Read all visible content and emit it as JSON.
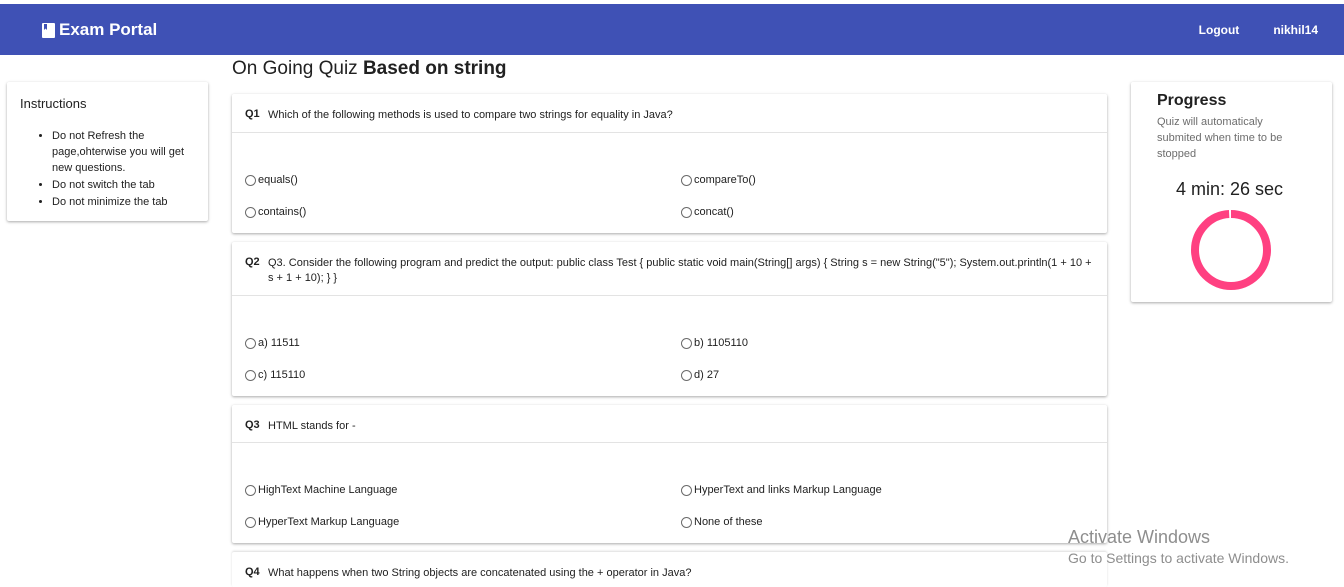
{
  "navbar": {
    "brand": "Exam Portal",
    "brand_icon": "book-icon",
    "logout": "Logout",
    "username": "nikhil14",
    "color": "#3f51b5"
  },
  "instructions": {
    "title": "Instructions",
    "items": [
      "Do not Refresh the page,ohterwise you will get new questions.",
      "Do not switch the tab",
      "Do not minimize the tab"
    ]
  },
  "page": {
    "title_prefix": "On Going Quiz",
    "title_bold": "Based on string"
  },
  "questions": [
    {
      "num": "Q1",
      "text": "Which of the following methods is used to compare two strings for equality in Java?",
      "options": [
        "equals()",
        "compareTo()",
        "contains()",
        "concat()"
      ]
    },
    {
      "num": "Q2",
      "text": "Q3. Consider the following program and predict the output: public class Test { public static void main(String[] args) { String s = new String(\"5\"); System.out.println(1 + 10 + s + 1 + 10); } }",
      "options": [
        "a) 11511",
        "b) 1105110",
        "c) 115110",
        "d) 27"
      ]
    },
    {
      "num": "Q3",
      "text": "HTML stands for -",
      "options": [
        "HighText Machine Language",
        "HyperText and links Markup Language",
        "HyperText Markup Language",
        "None of these"
      ]
    },
    {
      "num": "Q4",
      "text": "What happens when two String objects are concatenated using the + operator in Java?",
      "options": []
    }
  ],
  "progress": {
    "title": "Progress",
    "subtitle": "Quiz will automaticaly submited when time to be stopped",
    "timer": "4 min: 26 sec",
    "ring_color": "#ff4081",
    "ring_fraction": 0.99
  },
  "watermark": {
    "line1": "Activate Windows",
    "line2": "Go to Settings to activate Windows."
  }
}
